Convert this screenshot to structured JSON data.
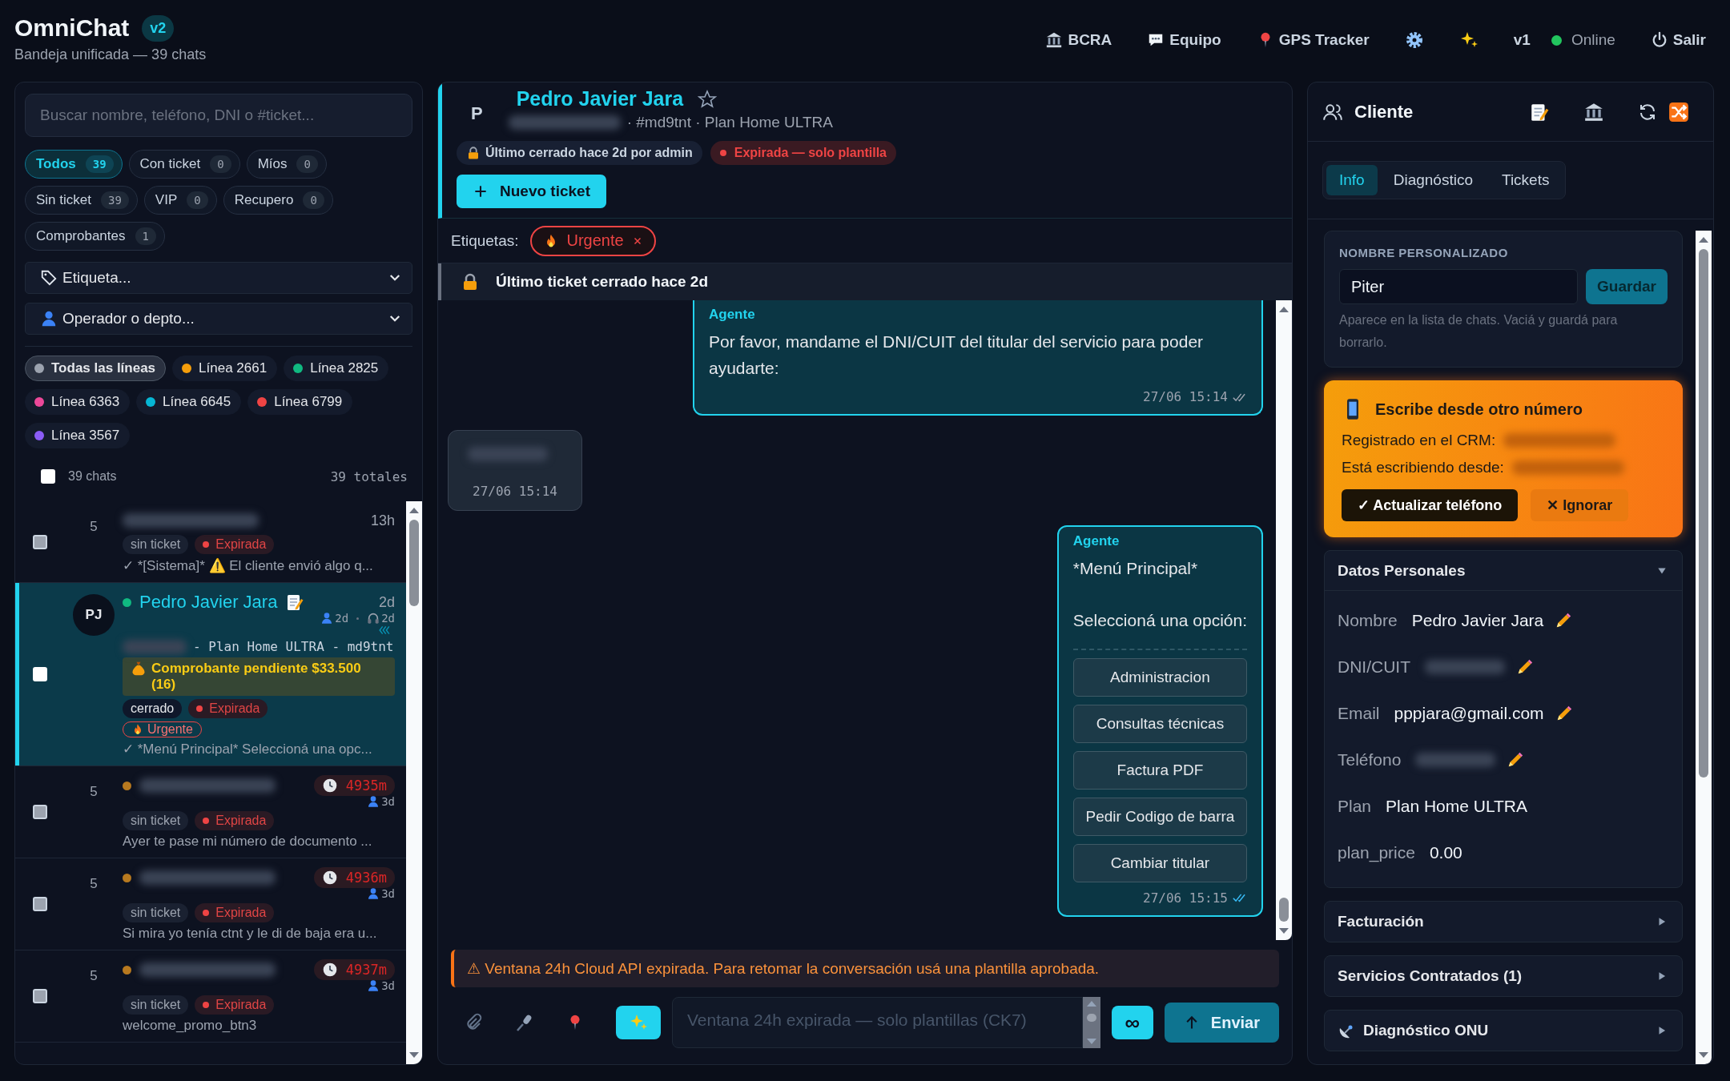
{
  "app": {
    "title": "OmniChat",
    "version": "v2",
    "subtitle": "Bandeja unificada — 39 chats"
  },
  "nav": [
    {
      "kind": "link",
      "label": "BCRA"
    },
    {
      "kind": "link",
      "label": "Equipo"
    },
    {
      "kind": "link",
      "label": "GPS Tracker"
    },
    {
      "kind": "icon"
    },
    {
      "kind": "icon"
    },
    {
      "kind": "text",
      "label": "v1"
    },
    {
      "kind": "status",
      "label": "Online",
      "color": "#22c55e"
    },
    {
      "kind": "link",
      "label": "Salir"
    }
  ],
  "inbox": {
    "search": {
      "placeholder": "Buscar nombre, teléfono, DNI o #ticket..."
    },
    "filters": [
      {
        "label": "Todos",
        "count": "39",
        "selected": true
      },
      {
        "label": "Con ticket",
        "count": "0",
        "selected": false
      },
      {
        "label": "Míos",
        "count": "0",
        "selected": false
      },
      {
        "label": "Sin ticket",
        "count": "39",
        "selected": false
      },
      {
        "label": "VIP",
        "count": "0",
        "selected": false
      },
      {
        "label": "Recupero",
        "count": "0",
        "selected": false
      },
      {
        "label": "Comprobantes",
        "count": "1",
        "selected": false
      }
    ],
    "selects": [
      {
        "label": "Etiqueta..."
      },
      {
        "label": "Operador o depto..."
      }
    ],
    "lines": [
      {
        "label": "Todas las líneas",
        "color": "#9ca3af",
        "selected": true
      },
      {
        "label": "Línea 2661",
        "color": "#f59e0b",
        "selected": false
      },
      {
        "label": "Línea 2825",
        "color": "#10b981",
        "selected": false
      },
      {
        "label": "Línea 6363",
        "color": "#ec4899",
        "selected": false
      },
      {
        "label": "Línea 6645",
        "color": "#06b6d4",
        "selected": false
      },
      {
        "label": "Línea 6799",
        "color": "#ef4444",
        "selected": false
      },
      {
        "label": "Línea 3567",
        "color": "#8b5cf6",
        "selected": false
      }
    ],
    "list_header": {
      "label": "39 chats",
      "checked": false,
      "total": "39 totales"
    },
    "chats": [
      {
        "selected": false,
        "checked": false,
        "count": "5",
        "time": "13h",
        "tags": [
          {
            "kind": "none",
            "label": "sin ticket"
          },
          {
            "kind": "expired",
            "label": "Expirada"
          }
        ],
        "preview": "✓ *[Sistema]* ⚠️ El cliente envió algo q..."
      },
      {
        "selected": true,
        "checked": false,
        "avatar": "PJ",
        "color": "#10b981",
        "name": "Pedro Javier Jara",
        "note": true,
        "time": "2d",
        "activity": [
          "2d",
          "2d"
        ],
        "reply_pending": true,
        "detail": "- Plan Home ULTRA - md9tnt",
        "notice": "Comprobante pendiente $33.500 (16)",
        "tags": [
          {
            "kind": "closed",
            "label": "cerrado"
          },
          {
            "kind": "expired",
            "label": "Expirada"
          }
        ],
        "labels": [
          "Urgente"
        ],
        "preview": "✓ *Menú Principal* Seleccioná una opc..."
      },
      {
        "selected": false,
        "checked": false,
        "count": "5",
        "color": "#b7791f",
        "timer": "4935m",
        "activity": [
          "3d"
        ],
        "tags": [
          {
            "kind": "none",
            "label": "sin ticket"
          },
          {
            "kind": "expired",
            "label": "Expirada"
          }
        ],
        "preview": "Ayer te pase mi número de documento ..."
      },
      {
        "selected": false,
        "checked": false,
        "count": "5",
        "color": "#b7791f",
        "timer": "4936m",
        "activity": [
          "3d"
        ],
        "tags": [
          {
            "kind": "none",
            "label": "sin ticket"
          },
          {
            "kind": "expired",
            "label": "Expirada"
          }
        ],
        "preview": "Si mira yo tenía ctnt y le di de baja era u..."
      },
      {
        "selected": false,
        "checked": false,
        "count": "5",
        "color": "#b7791f",
        "timer": "4937m",
        "activity": [
          "3d"
        ],
        "tags": [
          {
            "kind": "none",
            "label": "sin ticket"
          },
          {
            "kind": "expired",
            "label": "Expirada"
          }
        ],
        "preview": "welcome_promo_btn3"
      }
    ]
  },
  "conversation": {
    "avatar": "P",
    "name": "Pedro Javier Jara",
    "starred": false,
    "detail": "· #md9tnt · Plan Home ULTRA",
    "chips": [
      {
        "kind": "closed",
        "label": "Último cerrado hace 2d por admin"
      },
      {
        "kind": "expired",
        "label": "Expirada — solo plantilla"
      }
    ],
    "new_ticket": "Nuevo ticket",
    "tags_label": "Etiquetas:",
    "tags": [
      "Urgente"
    ],
    "notice": "Último ticket cerrado hace 2d",
    "messages": [
      {
        "kind": "outgoing",
        "author": "Agente",
        "text": "Por favor, mandame el DNI/CUIT del titular del servicio para poder ayudarte:",
        "time": "27/06 15:14",
        "read": false
      },
      {
        "kind": "incoming",
        "time": "27/06 15:14"
      },
      {
        "kind": "outgoing",
        "author": "Agente",
        "text": "*Menú Principal*\n\nSeleccioná una opción:",
        "options": [
          "Administracion",
          "Consultas técnicas",
          "Factura PDF",
          "Pedir Codigo de barra",
          "Cambiar titular"
        ],
        "time": "27/06 15:15",
        "read": true
      }
    ],
    "warning": "⚠ Ventana 24h Cloud API expirada. Para retomar la conversación usá una plantilla aprobada.",
    "composer": {
      "placeholder": "Ventana 24h expirada — solo plantillas (CK7)",
      "loop": "∞",
      "send": "Enviar"
    }
  },
  "client": {
    "title": "Cliente",
    "tabs": [
      {
        "label": "Info",
        "selected": true
      },
      {
        "label": "Diagnóstico",
        "selected": false
      },
      {
        "label": "Tickets",
        "selected": false
      }
    ],
    "custom_name": {
      "label": "NOMBRE PERSONALIZADO",
      "value": "Piter",
      "button": "Guardar",
      "hint": "Aparece en la lista de chats. Vaciá y guardá para borrarlo."
    },
    "alert": {
      "title": "Escribe desde otro número",
      "lines": [
        "Registrado en el CRM:",
        "Está escribiendo desde:"
      ],
      "actions": [
        {
          "kind": "primary",
          "label": "✓ Actualizar teléfono"
        },
        {
          "kind": "secondary",
          "label": "✕ Ignorar"
        }
      ]
    },
    "sections": [
      {
        "kind": "plain",
        "title": "Datos Personales",
        "expanded": true,
        "fields": [
          {
            "label": "Nombre",
            "value": "Pedro Javier Jara",
            "editable": true
          },
          {
            "label": "DNI/CUIT",
            "editable": true
          },
          {
            "label": "Email",
            "value": "pppjara@gmail.com",
            "editable": true
          },
          {
            "label": "Teléfono",
            "editable": true
          },
          {
            "label": "Plan",
            "value": "Plan Home ULTRA",
            "editable": false
          },
          {
            "label": "plan_price",
            "value": "0.00",
            "editable": false
          }
        ]
      },
      {
        "kind": "plain",
        "title": "Facturación",
        "expanded": false
      },
      {
        "kind": "plain",
        "title": "Servicios Contratados (1)",
        "expanded": false
      },
      {
        "kind": "diagnostic",
        "title": "Diagnóstico ONU",
        "expanded": false
      }
    ]
  }
}
